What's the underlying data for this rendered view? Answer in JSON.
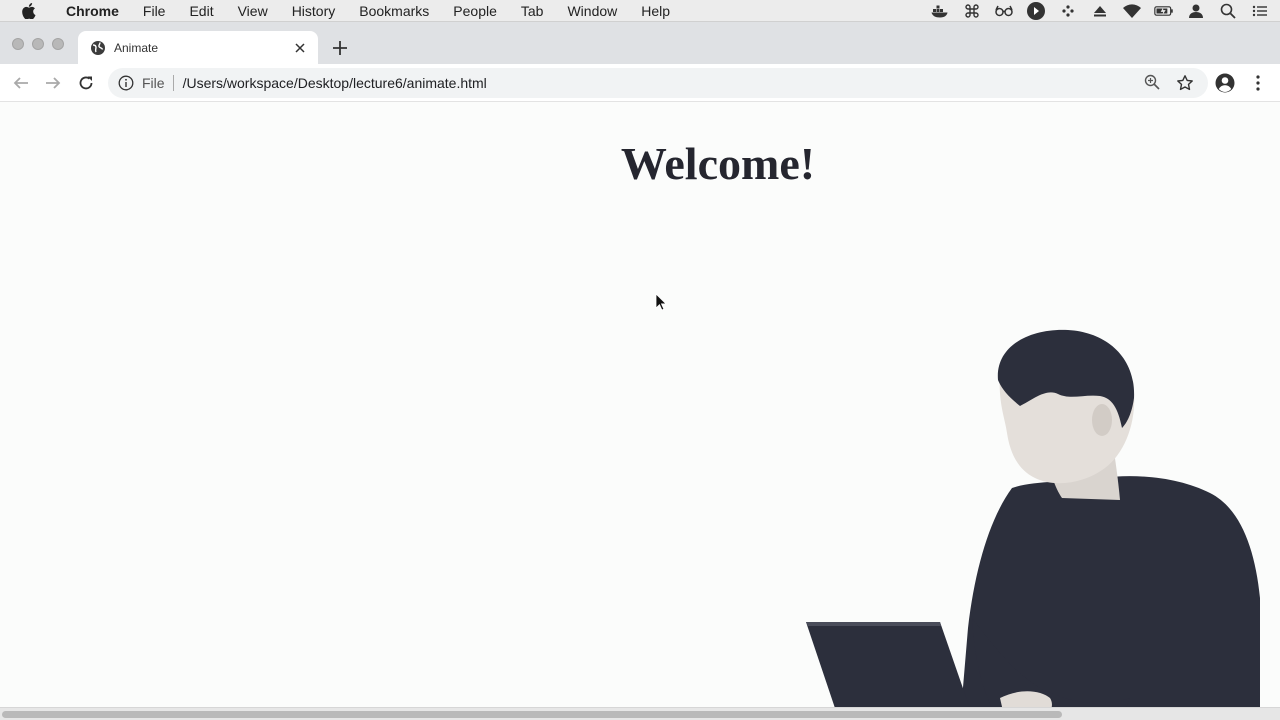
{
  "menubar": {
    "app_name": "Chrome",
    "items": [
      "File",
      "Edit",
      "View",
      "History",
      "Bookmarks",
      "People",
      "Tab",
      "Window",
      "Help"
    ],
    "status_icons": [
      "docker-icon",
      "command-icon",
      "glasses-icon",
      "play-circle-icon",
      "dots-grid-icon",
      "eject-icon",
      "wifi-icon",
      "battery-icon",
      "user-icon",
      "spotlight-search-icon",
      "list-icon"
    ]
  },
  "tab": {
    "title": "Animate",
    "favicon": "globe-icon"
  },
  "omnibox": {
    "scheme_label": "File",
    "url": "/Users/workspace/Desktop/lecture6/animate.html"
  },
  "page": {
    "heading": "Welcome!"
  },
  "colors": {
    "heading": "#25262f",
    "page_background": "#fbfcfb",
    "tabstrip": "#dfe1e4"
  }
}
